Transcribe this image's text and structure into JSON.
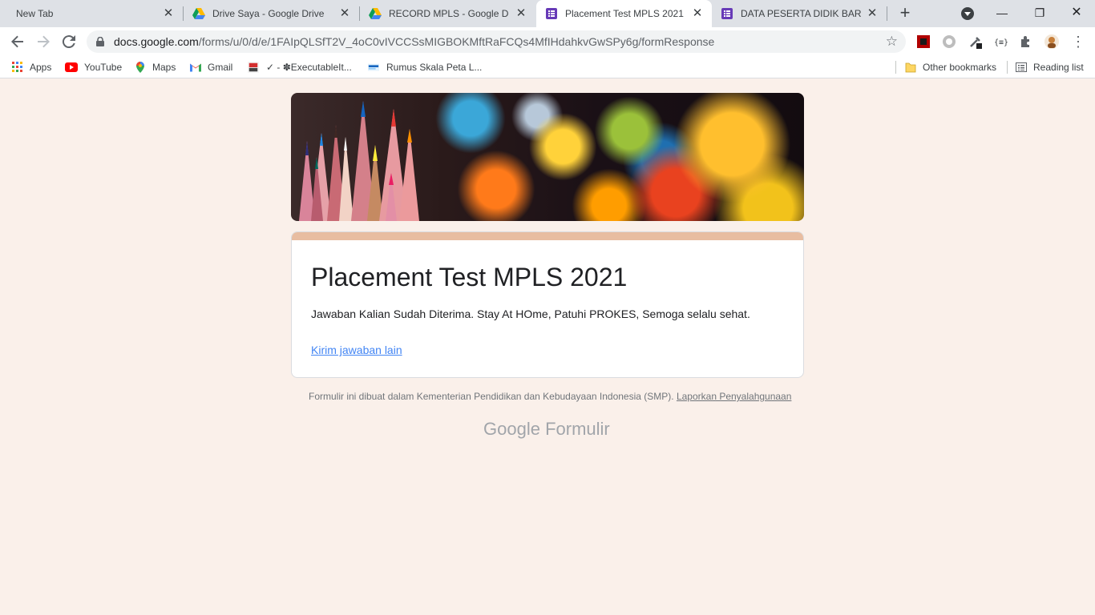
{
  "tabs": [
    {
      "title": "New Tab",
      "active": false,
      "icon": "none"
    },
    {
      "title": "Drive Saya - Google Drive",
      "active": false,
      "icon": "google-drive-icon"
    },
    {
      "title": "RECORD MPLS - Google Drive",
      "active": false,
      "icon": "google-drive-icon"
    },
    {
      "title": "Placement Test MPLS 2021",
      "active": true,
      "icon": "google-forms-icon"
    },
    {
      "title": "DATA PESERTA DIDIK BARU",
      "active": false,
      "icon": "google-forms-icon"
    }
  ],
  "window": {
    "minimize": "—",
    "restore": "❐",
    "close": "✕"
  },
  "toolbar": {
    "url_host": "docs.google.com",
    "url_path": "/forms/u/0/d/e/1FAIpQLSfT2V_4oC0vIVCCSsMIGBOKMftRaFCQs4MfIHdahkvGwSPy6g/formResponse"
  },
  "bookmarks": {
    "items": [
      {
        "label": "Apps",
        "icon": "apps-grid-icon"
      },
      {
        "label": "YouTube",
        "icon": "youtube-icon"
      },
      {
        "label": "Maps",
        "icon": "maps-pin-icon"
      },
      {
        "label": "Gmail",
        "icon": "gmail-icon"
      },
      {
        "label": "✓ - ✽ExecutableIt...",
        "icon": "bookmark-icon"
      },
      {
        "label": "Rumus Skala Peta L...",
        "icon": "bookmark-icon"
      }
    ],
    "other": "Other bookmarks",
    "reading_list": "Reading list"
  },
  "form": {
    "title": "Placement Test MPLS 2021",
    "message": "Jawaban Kalian Sudah Diterima. Stay At HOme, Patuhi PROKES, Semoga selalu sehat.",
    "submit_another": "Kirim jawaban lain"
  },
  "footer": {
    "text": "Formulir ini dibuat dalam Kementerian Pendidikan dan Kebudayaan Indonesia (SMP).",
    "report": "Laporkan Penyalahgunaan",
    "logo_google": "Google",
    "logo_forms": "Formulir"
  },
  "colors": {
    "page_bg": "#faf0ea",
    "card_accent": "#e8bda1",
    "link": "#4285f4"
  }
}
